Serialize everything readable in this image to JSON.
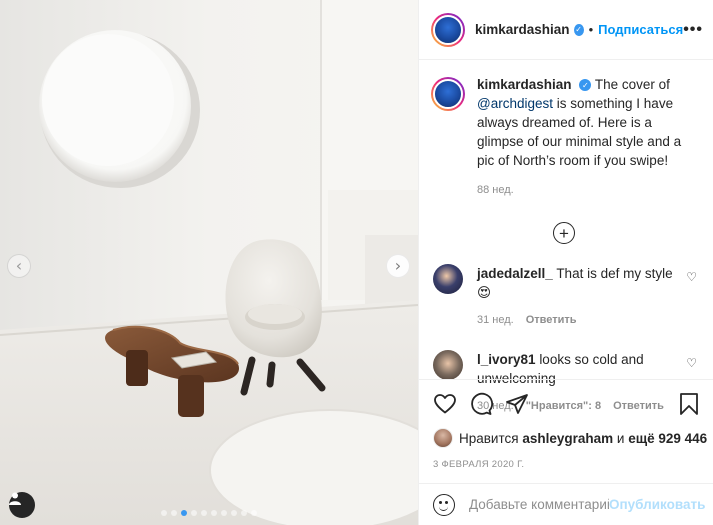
{
  "header": {
    "username": "kimkardashian",
    "separator": "•",
    "follow_label": "Подписаться",
    "more_label": "•••"
  },
  "caption": {
    "username": "kimkardashian",
    "mention": "@archdigest",
    "text_before": "The cover of",
    "text_after": "is something I have always dreamed of. Here is a glimpse of our minimal style and a pic of North’s room if you swipe!",
    "time": "88 нед."
  },
  "load_more": {
    "icon": "plus-circle-icon"
  },
  "comments": [
    {
      "username": "jadedalzell_",
      "text": "That is def my style 😍",
      "time": "31 нед.",
      "reply_label": "Ответить",
      "likes": "",
      "avatar_color": "#3a3f6b"
    },
    {
      "username": "l_ivory81",
      "text": "looks so cold and unwelcoming",
      "time": "30 нед.",
      "likes": "\"Нравится\": 8",
      "reply_label": "Ответить",
      "avatar_color": "#7a6a5e"
    }
  ],
  "likes": {
    "prefix": "Нравится",
    "user": "ashleygraham",
    "conjunction": "и",
    "others": "ещё 929 446"
  },
  "date": "3 ФЕВРАЛЯ 2020 Г.",
  "comment_box": {
    "placeholder": "Добавьте комментарий...",
    "post_label": "Опубликовать"
  },
  "carousel": {
    "total": 10,
    "active_index": 2
  },
  "colors": {
    "accent": "#0095f6",
    "active_dot": "#3897f0",
    "verified": "#3897f0"
  }
}
